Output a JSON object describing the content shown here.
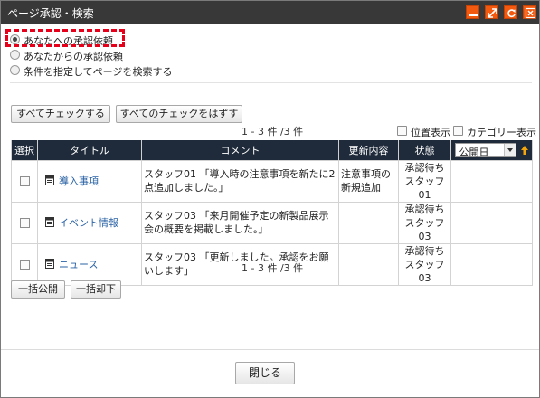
{
  "window": {
    "title": "ページ承認・検索",
    "controls": [
      "minimize-icon",
      "maximize-icon",
      "refresh-icon",
      "close-icon"
    ],
    "accent_color": "#f35a0f"
  },
  "options": [
    {
      "label": "あなたへの承認依頼",
      "selected": true
    },
    {
      "label": "あなたからの承認依頼",
      "selected": false
    },
    {
      "label": "条件を指定してページを検索する",
      "selected": false
    }
  ],
  "buttons": {
    "check_all": "すべてチェックする",
    "uncheck_all": "すべてのチェックをはずす",
    "bulk_publish": "一括公開",
    "bulk_reject": "一括却下",
    "close": "閉じる"
  },
  "pager": {
    "top": "1 - 3 件 /3 件",
    "bottom": "1 - 3 件 /3 件"
  },
  "display_options": {
    "position_label": "位置表示",
    "category_label": "カテゴリー表示"
  },
  "table": {
    "headers": {
      "select": "選択",
      "title": "タイトル",
      "comment": "コメント",
      "update": "更新内容",
      "status": "状態"
    },
    "sort": {
      "selected": "公開日"
    },
    "rows": [
      {
        "title": "導入事項",
        "comment": "スタッフ01 「導入時の注意事項を新たに2点追加しました。」",
        "update": "注意事項の新規追加",
        "status_line1": "承認待ち",
        "status_line2": "スタッフ01"
      },
      {
        "title": "イベント情報",
        "comment": "スタッフ03 「来月開催予定の新製品展示会の概要を掲載しました。」",
        "update": "",
        "status_line1": "承認待ち",
        "status_line2": "スタッフ03"
      },
      {
        "title": "ニュース",
        "comment": "スタッフ03 「更新しました。承認をお願いします」",
        "update": "",
        "status_line1": "承認待ち",
        "status_line2": "スタッフ03"
      }
    ]
  }
}
